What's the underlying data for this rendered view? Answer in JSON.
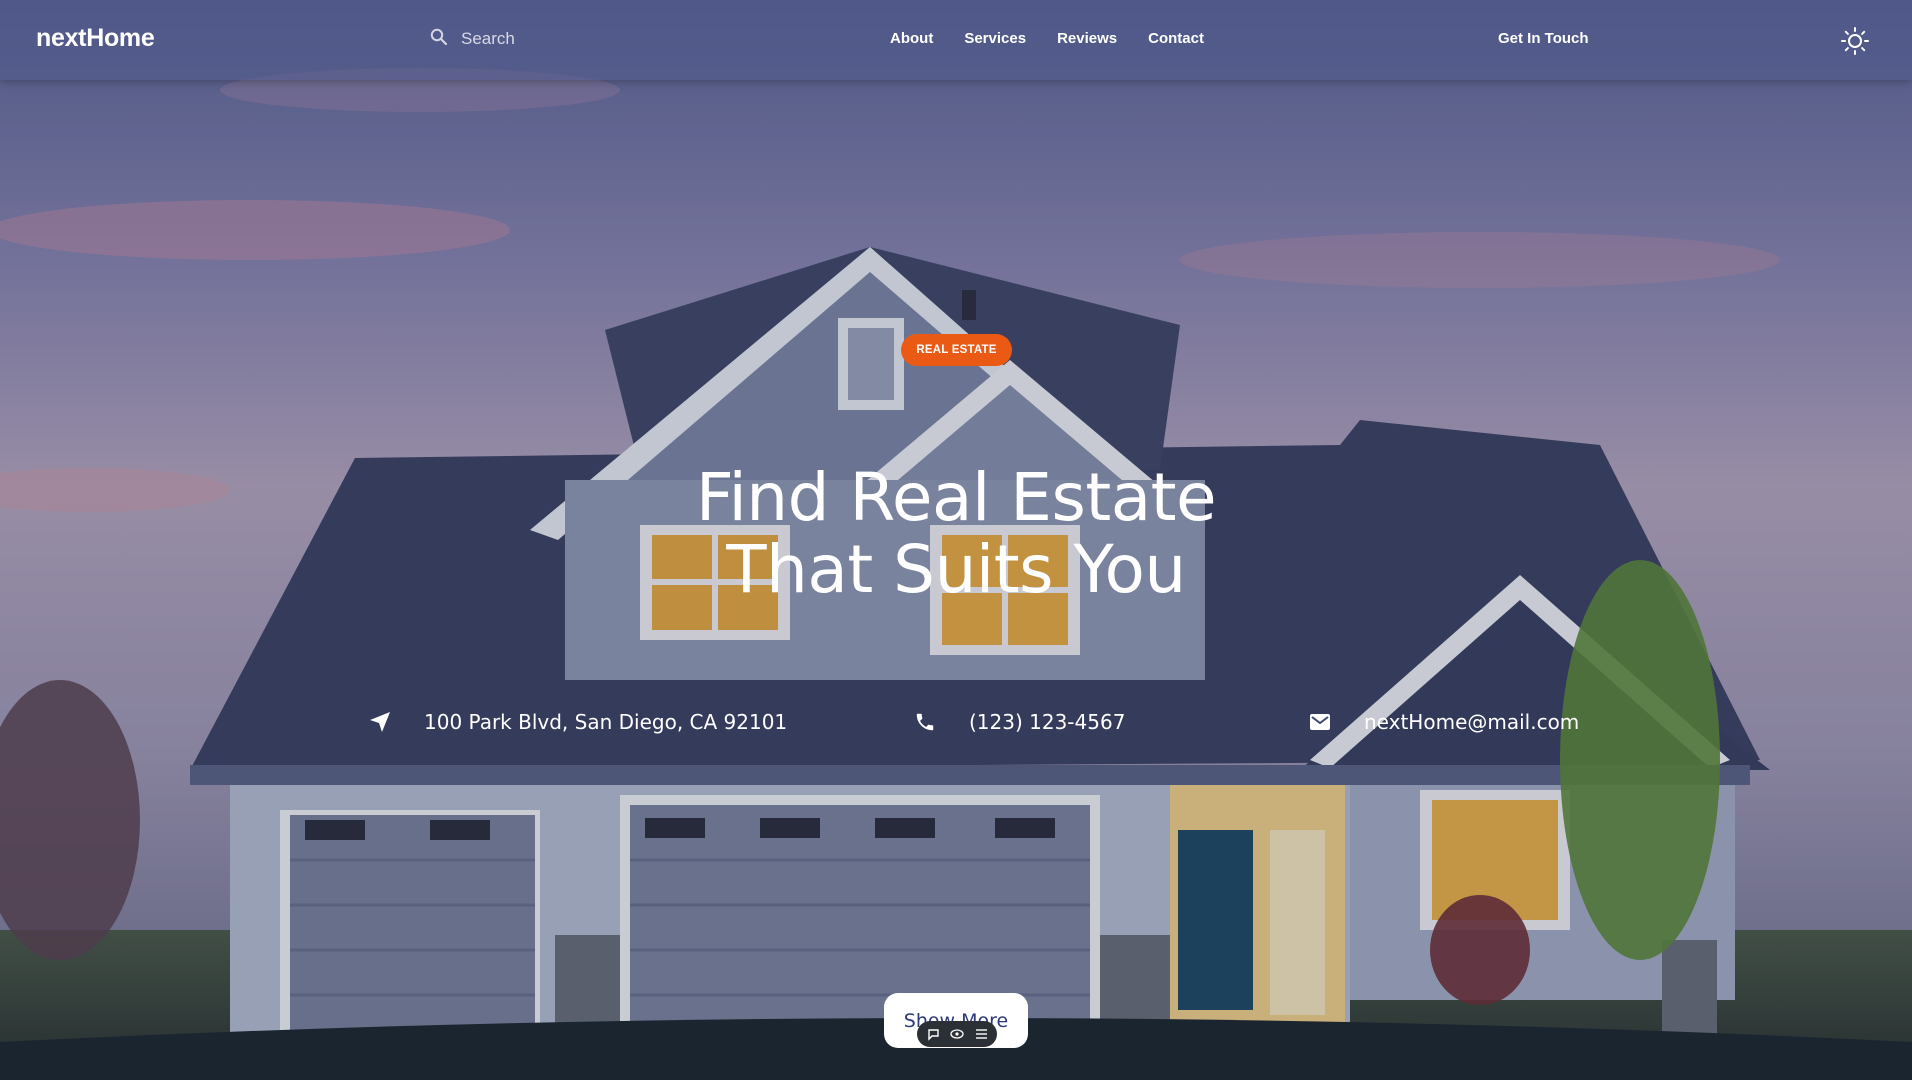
{
  "brand": {
    "logo": "nextHome"
  },
  "search": {
    "placeholder": "Search",
    "icon": "search-icon"
  },
  "nav": {
    "links": [
      "About",
      "Services",
      "Reviews",
      "Contact"
    ],
    "cta": "Get In Touch",
    "theme_icon": "sun-icon"
  },
  "hero": {
    "badge": "REAL ESTATE",
    "headline_line1": "Find Real Estate",
    "headline_line2": "That Suits You",
    "address": "100 Park Blvd, San Diego, CA 92101",
    "phone": "(123) 123-4567",
    "email": "nextHome@mail.com",
    "show_more": "Show More"
  },
  "colors": {
    "badge": "#ea5a14",
    "navbar": "#505a8c",
    "button_text": "#2d3a78",
    "footer_curve": "#1b2530"
  }
}
